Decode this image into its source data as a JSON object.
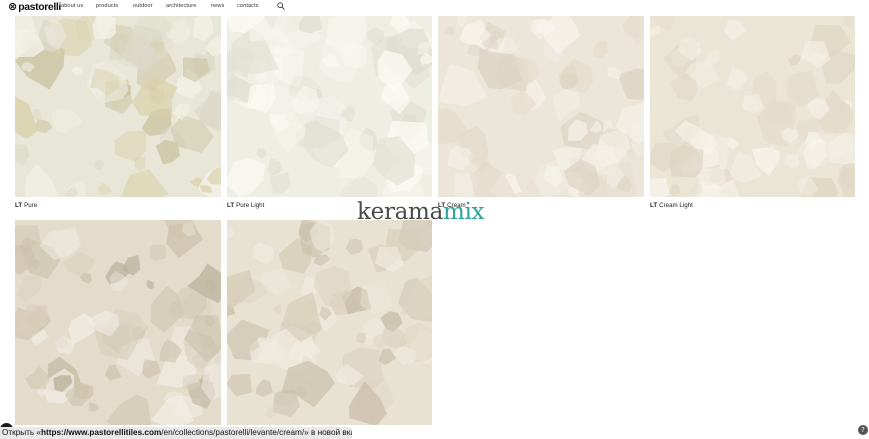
{
  "header": {
    "logo_mark": "⊗",
    "logo_text": "pastorelli",
    "nav": [
      "about us",
      "products",
      "outdoor",
      "architecture",
      "news",
      "contacts"
    ],
    "search_icon": "search-icon"
  },
  "tiles": [
    {
      "prefix": "LT",
      "name": "Pure",
      "base": "#e8e6d6"
    },
    {
      "prefix": "LT",
      "name": "Pure Light",
      "base": "#efeee4"
    },
    {
      "prefix": "LT",
      "name": "Cream",
      "base": "#ece6d9"
    },
    {
      "prefix": "LT",
      "name": "Cream Light",
      "base": "#ebe5d6"
    },
    {
      "prefix": "",
      "name": "",
      "base": "#e3dccb"
    },
    {
      "prefix": "",
      "name": "",
      "base": "#e8e2d3"
    }
  ],
  "overlay": {
    "part1": "kerama",
    "part2": "mix",
    "color1": "#4a4a4a",
    "color2": "#2aa59b"
  },
  "statusbar": {
    "before": "Открыть «",
    "host": "https://www.pastorellitiles.com",
    "path": "/en/collections/pastorelli/levante/cream/",
    "after": "» в новой вкладке"
  },
  "help": {
    "label": "?"
  }
}
